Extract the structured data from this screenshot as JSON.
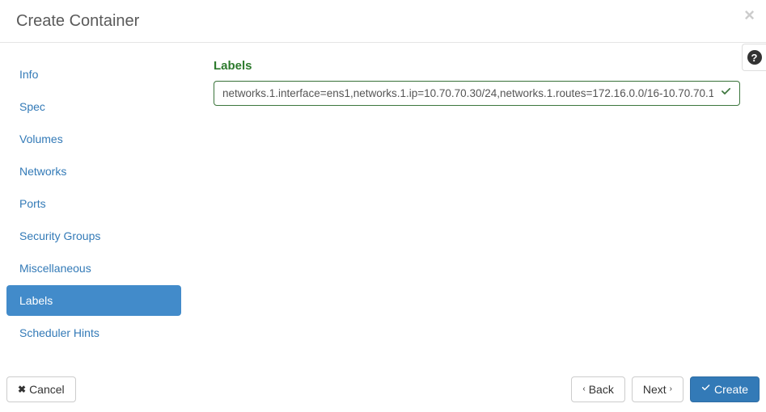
{
  "modal": {
    "title": "Create Container"
  },
  "sidebar": {
    "items": [
      {
        "label": "Info"
      },
      {
        "label": "Spec"
      },
      {
        "label": "Volumes"
      },
      {
        "label": "Networks"
      },
      {
        "label": "Ports"
      },
      {
        "label": "Security Groups"
      },
      {
        "label": "Miscellaneous"
      },
      {
        "label": "Labels"
      },
      {
        "label": "Scheduler Hints"
      }
    ],
    "active_index": 7
  },
  "main": {
    "section_title": "Labels",
    "labels_input_value": "networks.1.interface=ens1,networks.1.ip=10.70.70.30/24,networks.1.routes=172.16.0.0/16-10.70.70.1"
  },
  "footer": {
    "cancel_label": "Cancel",
    "back_label": "Back",
    "next_label": "Next",
    "create_label": "Create"
  }
}
